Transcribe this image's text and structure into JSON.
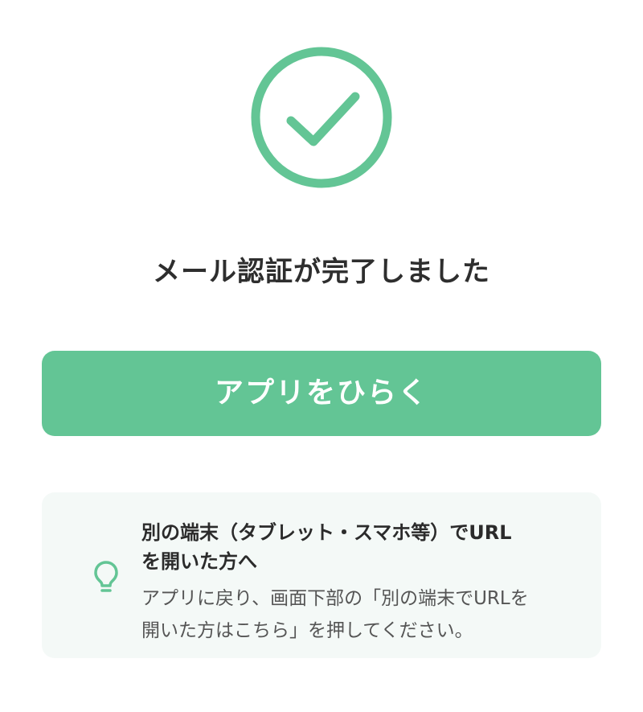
{
  "status": {
    "icon": "check-circle-icon",
    "title": "メール認証が完了しました"
  },
  "primary_action": {
    "label": "アプリをひらく"
  },
  "tip": {
    "icon": "lightbulb-icon",
    "heading_line1": "別の端末（タブレット・スマホ等）でURL",
    "heading_line2": "を開いた方へ",
    "body_line1": "アプリに戻り、画面下部の「別の端末でURLを",
    "body_line2": "開いた方はこちら」を押してください。"
  },
  "colors": {
    "accent": "#63c595",
    "tip_background": "#f4f9f7",
    "text": "#2b2b2b"
  }
}
